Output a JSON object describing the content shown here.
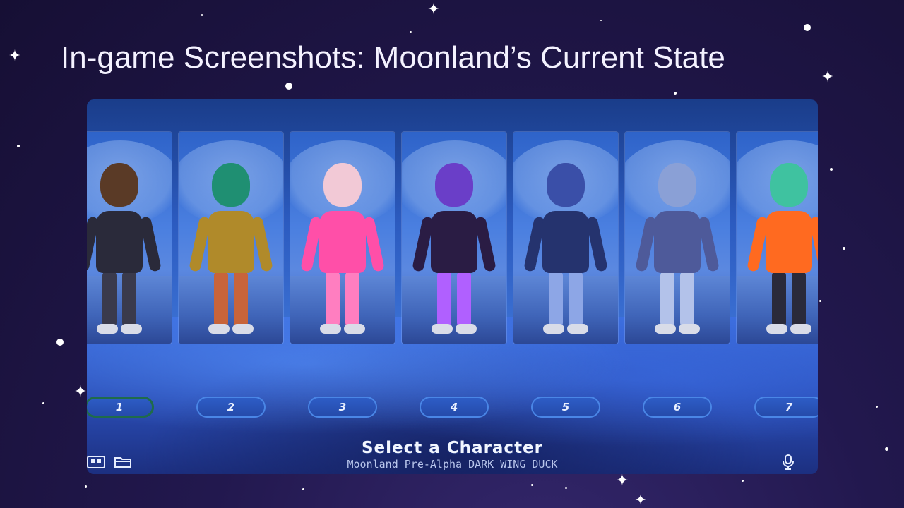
{
  "slide": {
    "title": "In-game Screenshots: Moonland’s Current State"
  },
  "game_screen": {
    "heading": "Select a Character",
    "subtitle": "Moonland Pre-Alpha DARK WING DUCK",
    "selected_slot": "1",
    "slots": [
      {
        "label": "1",
        "skin": "#5a3a26",
        "outfit": "#2a2a3a",
        "accent": "#3a3a4c"
      },
      {
        "label": "2",
        "skin": "#1f8f72",
        "outfit": "#b08a2a",
        "accent": "#c8643a"
      },
      {
        "label": "3",
        "skin": "#f2c9d6",
        "outfit": "#ff4fa8",
        "accent": "#ff7ec0"
      },
      {
        "label": "4",
        "skin": "#6a3ec8",
        "outfit": "#2a1c44",
        "accent": "#b060ff"
      },
      {
        "label": "5",
        "skin": "#3a4fa8",
        "outfit": "#25336e",
        "accent": "#8da6e6"
      },
      {
        "label": "6",
        "skin": "#8aa0d6",
        "outfit": "#4e5a9a",
        "accent": "#b3c2ea"
      },
      {
        "label": "7",
        "skin": "#3fc2a0",
        "outfit": "#ff6a20",
        "accent": "#2a2a3a"
      }
    ],
    "bottom_icons": [
      "controller-icon",
      "folder-icon",
      "microphone-icon"
    ]
  }
}
